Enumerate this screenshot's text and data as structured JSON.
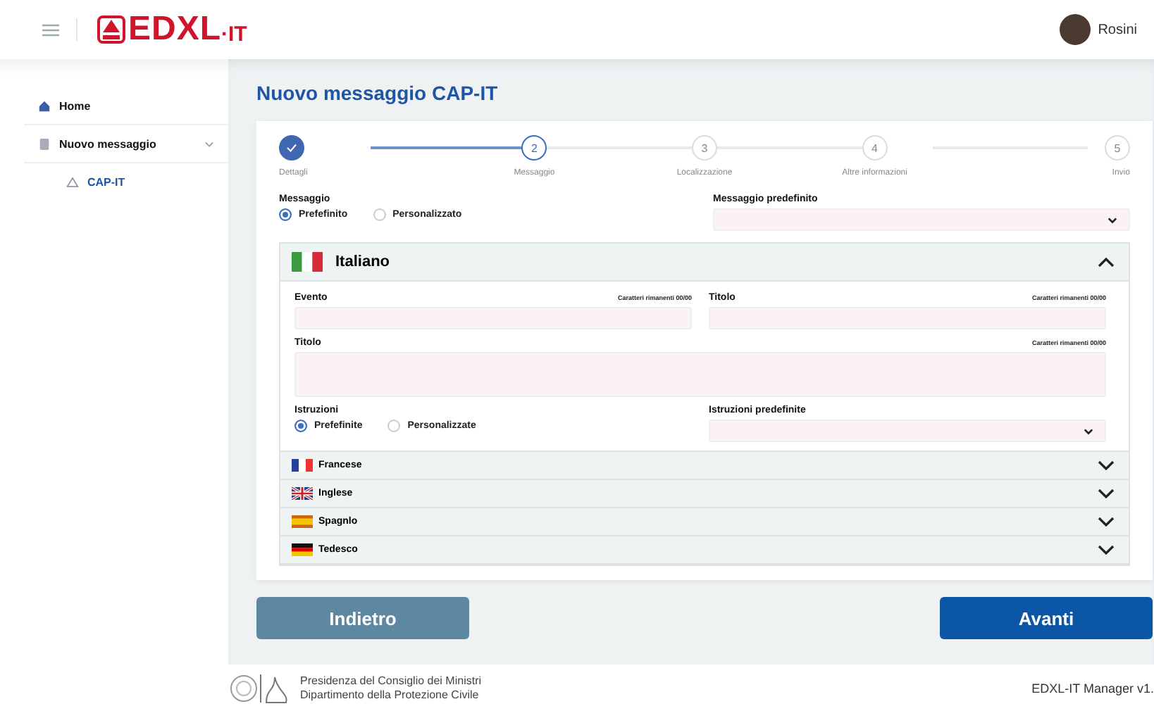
{
  "header": {
    "logo_name": "EDXL",
    "logo_suffix": "·IT",
    "user": "Rosini"
  },
  "sidebar": {
    "items": [
      {
        "label": "Home",
        "kind": "home",
        "selected": false
      },
      {
        "label": "Nuovo messaggio",
        "kind": "doc",
        "selected": false,
        "expanded": true,
        "children": [
          {
            "label": "CAP-IT",
            "kind": "alert",
            "selected": true
          }
        ]
      }
    ]
  },
  "page_title": "Nuovo messaggio CAP-IT",
  "steps": [
    {
      "label": "Dettagli",
      "done": true,
      "selected": false
    },
    {
      "number": "2",
      "label": "Messaggio",
      "done": false,
      "selected": true
    },
    {
      "number": "3",
      "label": "Localizzazione",
      "done": false,
      "selected": false
    },
    {
      "number": "4",
      "label": "Altre informazioni",
      "done": false,
      "selected": false
    },
    {
      "number": "5",
      "label": "Invio",
      "done": false,
      "selected": false
    }
  ],
  "message": {
    "label": "Messaggio",
    "options": [
      {
        "label": "Prefefinito",
        "selected": true
      },
      {
        "label": "Personalizzato",
        "selected": false
      }
    ],
    "select_label": "Messaggio predefinito"
  },
  "languages": [
    {
      "name": "Italiano",
      "kind": "it",
      "expanded": true
    },
    {
      "name": "Francese",
      "kind": "fr",
      "expanded": false
    },
    {
      "name": "Inglese",
      "kind": "gb",
      "expanded": false
    },
    {
      "name": "Spagnlo",
      "kind": "es",
      "expanded": false
    },
    {
      "name": "Tedesco",
      "kind": "de",
      "expanded": false
    }
  ],
  "language_form": {
    "event_label": "Evento",
    "event_counter": "Caratteri rimanenti 00/00",
    "title_label": "Titolo",
    "title_counter": "Caratteri rimanenti 00/00",
    "text_label": "Titolo",
    "text_counter": "Caratteri rimanenti 00/00",
    "instr_label": "Istruzioni",
    "instr_options": [
      {
        "label": "Prefefinite",
        "selected": true
      },
      {
        "label": "Personalizzate",
        "selected": false
      }
    ],
    "instr_select_label": "Istruzioni predefinite"
  },
  "buttons": {
    "back": "Indietro",
    "next": "Avanti"
  },
  "footer": {
    "org_line1": "Presidenza del Consiglio dei Ministri",
    "org_line2": "Dipartimento della Protezione Civile",
    "version": "EDXL-IT Manager v1."
  }
}
